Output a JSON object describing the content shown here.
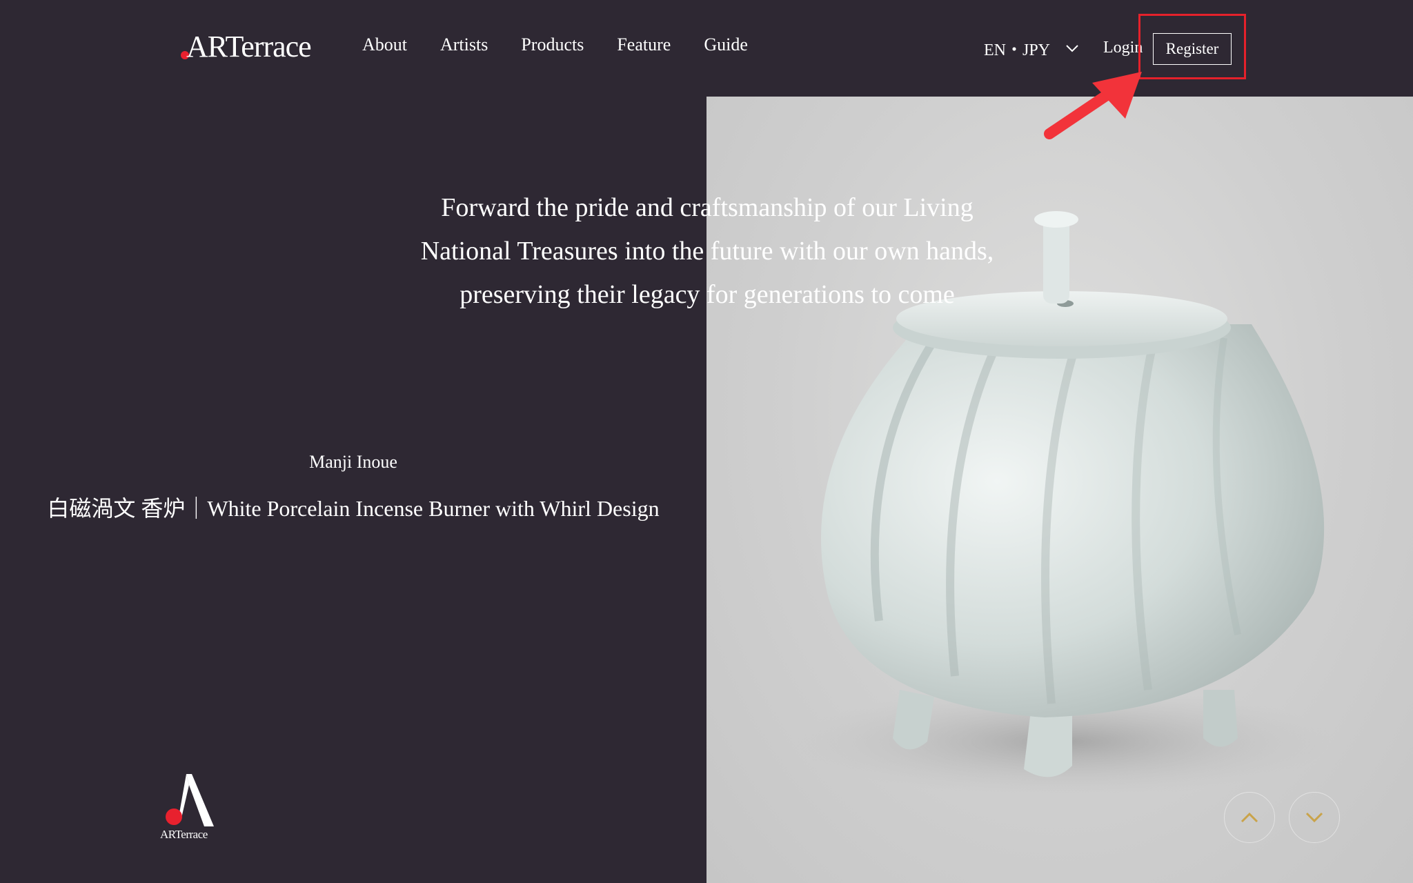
{
  "header": {
    "logo_text": "ARTerrace",
    "nav": [
      {
        "label": "About"
      },
      {
        "label": "Artists"
      },
      {
        "label": "Products"
      },
      {
        "label": "Feature"
      },
      {
        "label": "Guide"
      }
    ],
    "language_currency": "EN・JPY",
    "login_label": "Login",
    "register_label": "Register"
  },
  "hero": {
    "tagline": [
      "Forward the pride and craftsmanship of our Living",
      "National Treasures into the future with our own hands,",
      "preserving their legacy for generations to come"
    ],
    "artist_name": "Manji Inoue",
    "product_title": "白磁渦文 香炉｜White Porcelain Incense Burner with Whirl Design"
  },
  "footer_logo_text": "ARTerrace",
  "colors": {
    "background": "#2e2833",
    "accent_red": "#e8212e",
    "annotation_red": "#e5212b",
    "slider_arrow": "#c9a34a"
  },
  "icons": {
    "language_dropdown": "chevron-down-icon",
    "slide_prev": "chevron-up-icon",
    "slide_next": "chevron-down-icon",
    "annotation": "red-arrow-icon"
  }
}
